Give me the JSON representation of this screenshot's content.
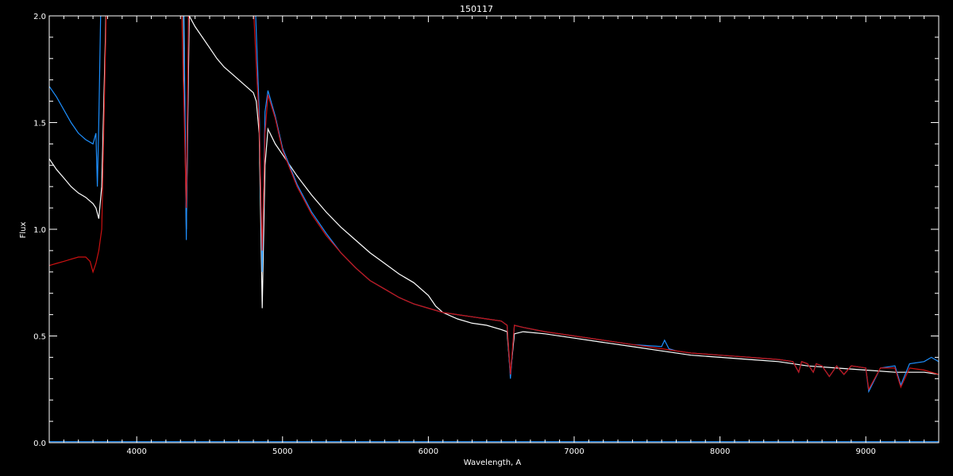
{
  "chart_data": {
    "type": "line",
    "title": "150117",
    "xlabel": "Wavelength, A",
    "ylabel": "Flux",
    "xlim": [
      3400,
      9500
    ],
    "ylim": [
      0.0,
      2.0
    ],
    "x_ticks": [
      {
        "value": 4000,
        "label": "4000"
      },
      {
        "value": 5000,
        "label": "5000"
      },
      {
        "value": 6000,
        "label": "6000"
      },
      {
        "value": 7000,
        "label": "7000"
      },
      {
        "value": 8000,
        "label": "8000"
      },
      {
        "value": 9000,
        "label": "9000"
      }
    ],
    "y_ticks": [
      {
        "value": 0.0,
        "label": "0.0"
      },
      {
        "value": 0.5,
        "label": "0.5"
      },
      {
        "value": 1.0,
        "label": "1.0"
      },
      {
        "value": 1.5,
        "label": "1.5"
      },
      {
        "value": 2.0,
        "label": "2.0"
      }
    ],
    "background_color": "#000000",
    "axis_color": "#ffffff",
    "grid": false,
    "series": [
      {
        "color": "#ffffff",
        "x": [
          3400,
          3450,
          3500,
          3550,
          3600,
          3650,
          3700,
          3720,
          3740,
          3760,
          3800,
          3850,
          3900,
          3950,
          4000,
          4050,
          4100,
          4150,
          4200,
          4250,
          4300,
          4320,
          4340,
          4360,
          4400,
          4450,
          4500,
          4550,
          4600,
          4650,
          4700,
          4750,
          4800,
          4820,
          4840,
          4861,
          4880,
          4900,
          4950,
          5000,
          5100,
          5200,
          5300,
          5400,
          5500,
          5600,
          5700,
          5800,
          5900,
          6000,
          6050,
          6100,
          6200,
          6300,
          6400,
          6500,
          6540,
          6563,
          6590,
          6650,
          6800,
          7000,
          7200,
          7400,
          7600,
          7800,
          8000,
          8200,
          8400,
          8600,
          8800,
          9000,
          9200,
          9400,
          9500
        ],
        "y": [
          1.33,
          1.28,
          1.24,
          1.2,
          1.17,
          1.15,
          1.12,
          1.1,
          1.05,
          1.2,
          2.3,
          2.3,
          2.3,
          2.3,
          2.3,
          2.3,
          2.3,
          2.3,
          2.3,
          2.3,
          2.3,
          2.05,
          1.0,
          2.0,
          1.95,
          1.9,
          1.85,
          1.8,
          1.76,
          1.73,
          1.7,
          1.67,
          1.64,
          1.6,
          1.45,
          0.63,
          1.3,
          1.47,
          1.4,
          1.35,
          1.25,
          1.16,
          1.08,
          1.01,
          0.95,
          0.89,
          0.84,
          0.79,
          0.75,
          0.69,
          0.64,
          0.61,
          0.58,
          0.56,
          0.55,
          0.53,
          0.52,
          0.32,
          0.51,
          0.52,
          0.51,
          0.49,
          0.47,
          0.45,
          0.43,
          0.41,
          0.4,
          0.39,
          0.38,
          0.36,
          0.35,
          0.34,
          0.33,
          0.33,
          0.32
        ]
      },
      {
        "color": "#1e90ff",
        "x": [
          3400,
          3450,
          3500,
          3550,
          3600,
          3650,
          3700,
          3720,
          3730,
          3740,
          3760,
          3800,
          3850,
          3900,
          3950,
          4000,
          4050,
          4100,
          4150,
          4200,
          4250,
          4300,
          4320,
          4340,
          4360,
          4400,
          4500,
          4600,
          4700,
          4800,
          4840,
          4861,
          4880,
          4900,
          4950,
          5000,
          5100,
          5200,
          5300,
          5400,
          5500,
          5600,
          5700,
          5800,
          5900,
          6000,
          6100,
          6200,
          6300,
          6400,
          6500,
          6540,
          6563,
          6590,
          6650,
          6800,
          7000,
          7200,
          7400,
          7600,
          7620,
          7650,
          7700,
          7800,
          8000,
          8200,
          8400,
          8500,
          8540,
          8560,
          8600,
          8640,
          8660,
          8700,
          8750,
          8800,
          8850,
          8900,
          9000,
          9020,
          9100,
          9200,
          9240,
          9300,
          9400,
          9450,
          9500
        ],
        "y": [
          1.67,
          1.62,
          1.56,
          1.5,
          1.45,
          1.42,
          1.4,
          1.45,
          1.2,
          1.5,
          2.3,
          2.3,
          2.3,
          2.3,
          2.3,
          2.3,
          2.3,
          2.3,
          2.3,
          2.3,
          2.3,
          2.3,
          2.3,
          0.95,
          2.3,
          2.3,
          2.3,
          2.3,
          2.3,
          2.3,
          1.55,
          0.8,
          1.55,
          1.65,
          1.53,
          1.38,
          1.21,
          1.08,
          0.98,
          0.89,
          0.82,
          0.76,
          0.72,
          0.68,
          0.65,
          0.63,
          0.61,
          0.6,
          0.59,
          0.58,
          0.57,
          0.55,
          0.3,
          0.55,
          0.54,
          0.52,
          0.5,
          0.48,
          0.46,
          0.45,
          0.48,
          0.44,
          0.43,
          0.42,
          0.41,
          0.4,
          0.39,
          0.38,
          0.33,
          0.38,
          0.37,
          0.33,
          0.37,
          0.36,
          0.31,
          0.36,
          0.32,
          0.36,
          0.35,
          0.24,
          0.35,
          0.36,
          0.27,
          0.37,
          0.38,
          0.4,
          0.38
        ]
      },
      {
        "color": "#cc1111",
        "x": [
          3400,
          3450,
          3500,
          3550,
          3600,
          3650,
          3680,
          3700,
          3720,
          3740,
          3760,
          3800,
          3850,
          3900,
          3950,
          4000,
          4050,
          4100,
          4150,
          4200,
          4250,
          4300,
          4340,
          4360,
          4400,
          4500,
          4600,
          4700,
          4800,
          4840,
          4861,
          4880,
          4900,
          4950,
          5000,
          5100,
          5200,
          5300,
          5400,
          5500,
          5600,
          5700,
          5800,
          5900,
          6000,
          6100,
          6200,
          6300,
          6400,
          6500,
          6540,
          6563,
          6590,
          6650,
          6800,
          7000,
          7200,
          7400,
          7600,
          7800,
          8000,
          8200,
          8400,
          8500,
          8540,
          8560,
          8600,
          8640,
          8660,
          8700,
          8750,
          8800,
          8850,
          8900,
          9000,
          9020,
          9100,
          9200,
          9240,
          9300,
          9400,
          9500
        ],
        "y": [
          0.83,
          0.84,
          0.85,
          0.86,
          0.87,
          0.87,
          0.85,
          0.8,
          0.84,
          0.9,
          1.0,
          2.3,
          2.3,
          2.3,
          2.3,
          2.3,
          2.3,
          2.3,
          2.3,
          2.3,
          2.3,
          2.3,
          1.1,
          2.3,
          2.3,
          2.3,
          2.3,
          2.3,
          2.05,
          1.5,
          0.9,
          1.45,
          1.63,
          1.52,
          1.37,
          1.2,
          1.07,
          0.97,
          0.89,
          0.82,
          0.76,
          0.72,
          0.68,
          0.65,
          0.63,
          0.61,
          0.6,
          0.59,
          0.58,
          0.57,
          0.55,
          0.32,
          0.55,
          0.54,
          0.52,
          0.5,
          0.48,
          0.46,
          0.44,
          0.42,
          0.41,
          0.4,
          0.39,
          0.38,
          0.33,
          0.38,
          0.37,
          0.33,
          0.37,
          0.36,
          0.31,
          0.36,
          0.32,
          0.36,
          0.35,
          0.25,
          0.35,
          0.35,
          0.26,
          0.35,
          0.34,
          0.32
        ]
      },
      {
        "color": "#1e90ff",
        "x": [
          3400,
          9500
        ],
        "y": [
          0.005,
          0.005
        ]
      }
    ]
  }
}
